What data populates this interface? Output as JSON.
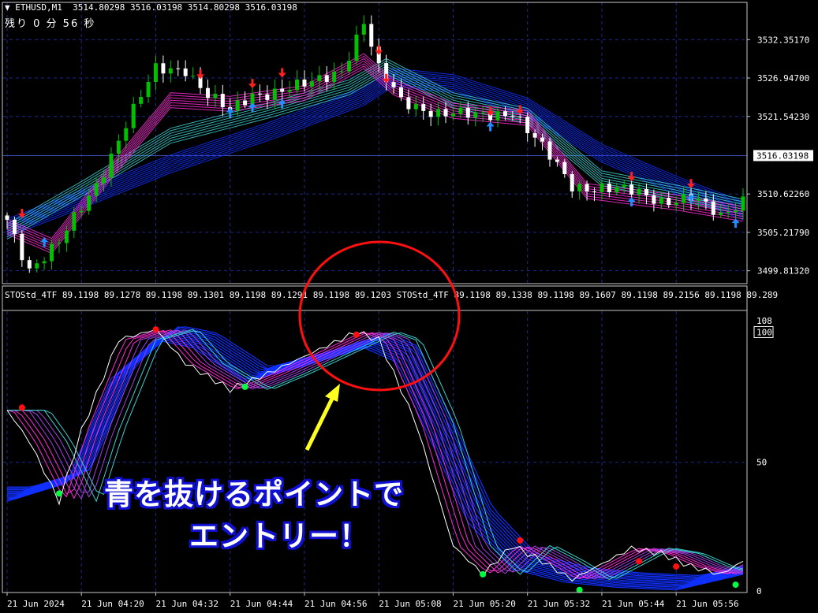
{
  "header": {
    "symbol": "ETHUSD,M1",
    "ohlc": "3514.80298 3516.03198 3514.80298 3516.03198",
    "countdown": "残り 0 分 56 秒"
  },
  "colors": {
    "background": "#000000",
    "grid": "#1c2a8c",
    "bull_candle": "#00c000",
    "bear_candle": "#ffffff",
    "ribbon_blue": "#1030ff",
    "ribbon_magenta": "#ff2bd6",
    "ribbon_teal": "#3ccfcf",
    "signal_up": "#1e90ff",
    "signal_down": "#ff2020",
    "dot_green": "#00ff40",
    "dot_red": "#ff1010",
    "circle": "#ff1010",
    "arrow": "#ffff20"
  },
  "chart_data": [
    {
      "type": "candlestick",
      "title": "ETHUSD,M1",
      "y_ticks": [
        "3532.35170",
        "3526.94700",
        "3521.54230",
        "3510.62260",
        "3505.21790",
        "3499.81320"
      ],
      "ylim": [
        3498.0,
        3537.6
      ],
      "current_price": "3516.03198",
      "x_ticks": [
        "21 Jun 2024",
        "21 Jun 04:20",
        "21 Jun 04:32",
        "21 Jun 04:44",
        "21 Jun 04:56",
        "21 Jun 05:08",
        "21 Jun 05:20",
        "21 Jun 05:32",
        "21 Jun 05:44",
        "21 Jun 05:56"
      ],
      "bars": 100,
      "close_path": [
        [
          0,
          3507.0
        ],
        [
          3,
          3500.2
        ],
        [
          7,
          3503.6
        ],
        [
          12,
          3512.0
        ],
        [
          16,
          3520.5
        ],
        [
          20,
          3528.0
        ],
        [
          24,
          3528.4
        ],
        [
          27,
          3524.6
        ],
        [
          30,
          3522.0
        ],
        [
          33,
          3524.6
        ],
        [
          37,
          3525.4
        ],
        [
          41,
          3526.0
        ],
        [
          45,
          3528.2
        ],
        [
          48,
          3535.0
        ],
        [
          50,
          3528.0
        ],
        [
          53,
          3523.6
        ],
        [
          58,
          3522.2
        ],
        [
          63,
          3521.4
        ],
        [
          68,
          3522.4
        ],
        [
          72,
          3517.0
        ],
        [
          76,
          3511.8
        ],
        [
          80,
          3511.6
        ],
        [
          84,
          3510.8
        ],
        [
          88,
          3509.8
        ],
        [
          92,
          3510.2
        ],
        [
          96,
          3507.2
        ],
        [
          99,
          3510.0
        ]
      ],
      "ribbons": [
        {
          "color": "blue",
          "path": [
            [
              0,
              3506.0
            ],
            [
              10,
              3510.0
            ],
            [
              22,
              3515.0
            ],
            [
              35,
              3519.5
            ],
            [
              48,
              3524.5
            ],
            [
              52,
              3527.2
            ],
            [
              60,
              3526.3
            ],
            [
              70,
              3523.0
            ],
            [
              80,
              3516.5
            ],
            [
              90,
              3512.0
            ],
            [
              99,
              3508.4
            ]
          ]
        },
        {
          "color": "teal",
          "path": [
            [
              0,
              3505.5
            ],
            [
              10,
              3511.5
            ],
            [
              22,
              3519.0
            ],
            [
              35,
              3522.5
            ],
            [
              46,
              3525.8
            ],
            [
              51,
              3528.8
            ],
            [
              60,
              3524.0
            ],
            [
              70,
              3521.8
            ],
            [
              80,
              3513.0
            ],
            [
              90,
              3511.0
            ],
            [
              99,
              3509.0
            ]
          ]
        },
        {
          "color": "magenta",
          "path": [
            [
              0,
              3506.2
            ],
            [
              6,
              3503.5
            ],
            [
              14,
              3514.0
            ],
            [
              22,
              3524.0
            ],
            [
              30,
              3523.5
            ],
            [
              40,
              3525.0
            ],
            [
              48,
              3529.5
            ],
            [
              52,
              3525.8
            ],
            [
              60,
              3522.5
            ],
            [
              70,
              3521.5
            ],
            [
              78,
              3511.2
            ],
            [
              90,
              3509.6
            ],
            [
              99,
              3508.0
            ]
          ]
        }
      ],
      "arrows_up": [
        [
          5,
          3503.5
        ],
        [
          30,
          3521.8
        ],
        [
          33,
          3522.5
        ],
        [
          37,
          3523.0
        ],
        [
          65,
          3519.8
        ],
        [
          84,
          3509.2
        ],
        [
          92,
          3509.6
        ],
        [
          98,
          3506.2
        ]
      ],
      "arrows_down": [
        [
          2,
          3508.2
        ],
        [
          26,
          3527.8
        ],
        [
          33,
          3526.5
        ],
        [
          37,
          3528.0
        ],
        [
          50,
          3531.2
        ],
        [
          51,
          3527.2
        ],
        [
          65,
          3522.6
        ],
        [
          69,
          3522.8
        ],
        [
          84,
          3513.4
        ],
        [
          92,
          3512.4
        ]
      ]
    },
    {
      "type": "line",
      "title": "STOStd_4TF",
      "label": "STOStd_4TF 89.1198 89.1278 89.1198 89.1301 89.1198 89.1291 89.1198 89.1203 STOStd_4TF 89.1198 89.1338 89.1198 89.1607 89.1198 89.2156 89.1198 89.289",
      "y_ticks": [
        "108",
        "100",
        "50",
        "0"
      ],
      "ylim": [
        0,
        108
      ],
      "stochastic_path": [
        [
          0,
          70
        ],
        [
          3,
          58
        ],
        [
          7,
          35
        ],
        [
          10,
          62
        ],
        [
          15,
          97
        ],
        [
          20,
          101
        ],
        [
          24,
          88
        ],
        [
          30,
          78
        ],
        [
          35,
          84
        ],
        [
          41,
          92
        ],
        [
          47,
          100
        ],
        [
          50,
          97
        ],
        [
          55,
          65
        ],
        [
          60,
          18
        ],
        [
          64,
          7
        ],
        [
          68,
          18
        ],
        [
          72,
          12
        ],
        [
          76,
          5
        ],
        [
          80,
          11
        ],
        [
          84,
          17
        ],
        [
          88,
          15
        ],
        [
          92,
          10
        ],
        [
          96,
          7
        ],
        [
          99,
          12
        ]
      ],
      "blue_band_path": [
        [
          0,
          38
        ],
        [
          8,
          45
        ],
        [
          14,
          85
        ],
        [
          20,
          100
        ],
        [
          25,
          97
        ],
        [
          32,
          84
        ],
        [
          40,
          90
        ],
        [
          48,
          97
        ],
        [
          52,
          92
        ],
        [
          58,
          55
        ],
        [
          62,
          30
        ],
        [
          68,
          12
        ],
        [
          75,
          7
        ],
        [
          82,
          5
        ],
        [
          90,
          4
        ],
        [
          99,
          10
        ]
      ],
      "dots_green": [
        [
          7,
          38
        ],
        [
          32,
          79
        ],
        [
          64,
          7
        ],
        [
          77,
          1
        ],
        [
          98,
          3
        ]
      ],
      "dots_red": [
        [
          2,
          71
        ],
        [
          20,
          101
        ],
        [
          47,
          99
        ],
        [
          69,
          20
        ],
        [
          85,
          12
        ],
        [
          90,
          10
        ]
      ]
    }
  ],
  "annotation": {
    "line1": "青を抜けるポイントで",
    "line2": "エントリー！"
  }
}
